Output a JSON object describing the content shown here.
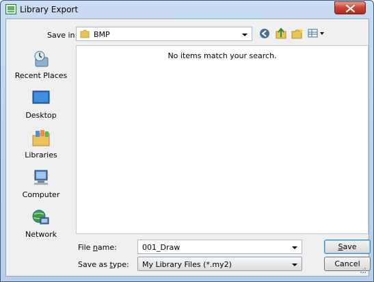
{
  "window": {
    "title": "Library Export",
    "close_icon": "close-icon"
  },
  "save_in": {
    "label": "Save in:",
    "value": "BMP"
  },
  "toolbar": {
    "icons": [
      "back-icon",
      "up-folder-icon",
      "new-folder-icon",
      "view-menu-icon"
    ]
  },
  "places": [
    {
      "label": "Recent Places",
      "icon": "recent-places-icon"
    },
    {
      "label": "Desktop",
      "icon": "desktop-icon"
    },
    {
      "label": "Libraries",
      "icon": "libraries-icon"
    },
    {
      "label": "Computer",
      "icon": "computer-icon"
    },
    {
      "label": "Network",
      "icon": "network-icon"
    }
  ],
  "file_list": {
    "empty_message": "No items match your search."
  },
  "file_name": {
    "label": "File name:",
    "value": "001_Draw"
  },
  "save_as_type": {
    "label": "Save as type:",
    "value": "My Library Files (*.my2)"
  },
  "buttons": {
    "save": "Save",
    "cancel": "Cancel"
  },
  "colors": {
    "title_bar": "#b9d1ea",
    "close_button": "#c9483a",
    "dialog_bg": "#f0f0f0"
  }
}
